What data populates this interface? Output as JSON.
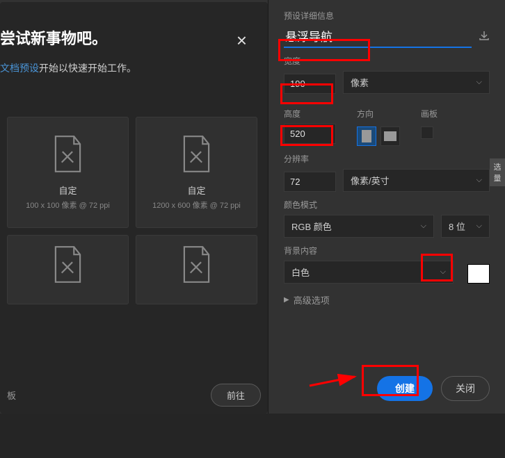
{
  "left": {
    "title": "尝试新事物吧。",
    "subtitle_prefix": "文档预设",
    "subtitle_suffix": "开始以快速开始工作。",
    "presets": [
      {
        "name": "自定",
        "dims": "100 x 100 像素 @ 72 ppi"
      },
      {
        "name": "自定",
        "dims": "1200 x 600 像素 @ 72 ppi"
      },
      {
        "name": "",
        "dims": ""
      },
      {
        "name": "",
        "dims": ""
      }
    ],
    "bottom_label": "板",
    "goto": "前往"
  },
  "right": {
    "header_label": "预设详细信息",
    "name_value": "悬浮导航",
    "width_label": "宽度",
    "width_value": "190",
    "width_unit": "像素",
    "height_label": "高度",
    "height_value": "520",
    "orientation_label": "方向",
    "artboard_label": "画板",
    "resolution_label": "分辨率",
    "resolution_value": "72",
    "resolution_unit": "像素/英寸",
    "color_mode_label": "颜色模式",
    "color_mode_value": "RGB 颜色",
    "color_depth": "8 位",
    "bg_label": "背景内容",
    "bg_value": "白色",
    "bg_color": "#ffffff",
    "advanced_label": "高级选项",
    "create": "创建",
    "close": "关闭"
  },
  "side_tab": "选量"
}
